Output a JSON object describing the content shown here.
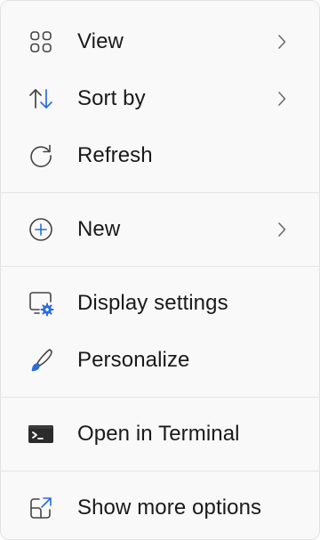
{
  "menu": {
    "groups": [
      {
        "items": [
          {
            "label": "View",
            "icon": "grid-view-icon",
            "has_submenu": true
          },
          {
            "label": "Sort by",
            "icon": "sort-arrows-icon",
            "has_submenu": true
          },
          {
            "label": "Refresh",
            "icon": "refresh-icon",
            "has_submenu": false
          }
        ]
      },
      {
        "items": [
          {
            "label": "New",
            "icon": "add-circle-icon",
            "has_submenu": true
          }
        ]
      },
      {
        "items": [
          {
            "label": "Display settings",
            "icon": "display-settings-icon",
            "has_submenu": false
          },
          {
            "label": "Personalize",
            "icon": "brush-icon",
            "has_submenu": false
          }
        ]
      },
      {
        "items": [
          {
            "label": "Open in Terminal",
            "icon": "terminal-icon",
            "has_submenu": false
          }
        ]
      },
      {
        "items": [
          {
            "label": "Show more options",
            "icon": "open-external-icon",
            "has_submenu": false
          }
        ]
      }
    ]
  },
  "colors": {
    "accent": "#2a6cdb",
    "text": "#1a1a1a",
    "icon": "#444444",
    "chevron": "#6b6b6b",
    "separator": "#e5e5e5"
  }
}
